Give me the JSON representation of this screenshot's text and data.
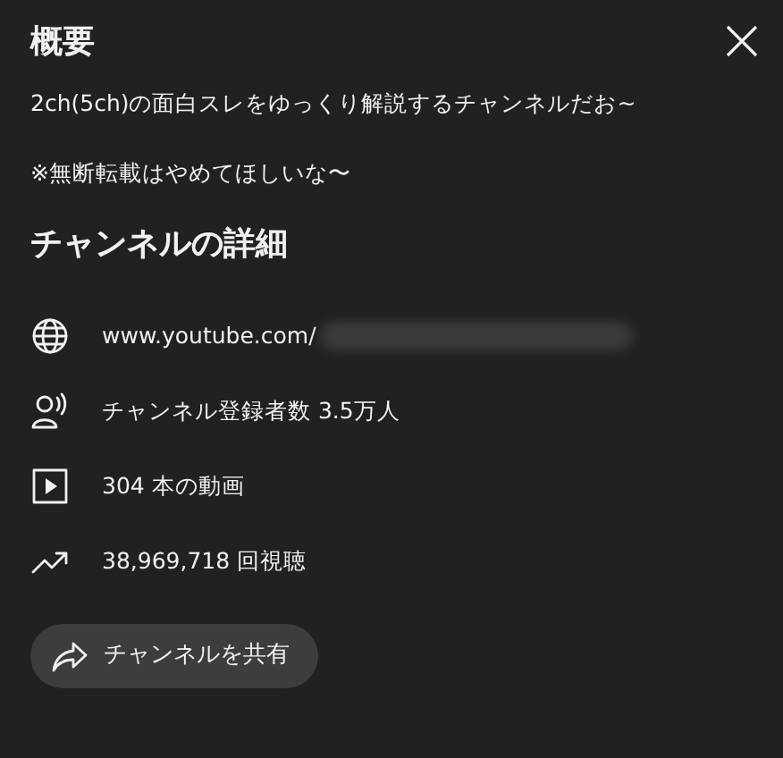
{
  "title": "概要",
  "description": [
    "2ch(5ch)の面白スレをゆっくり解説するチャンネルだお~",
    "※無断転載はやめてほしいな〜"
  ],
  "details_heading": "チャンネルの詳細",
  "details": [
    {
      "kind": "link",
      "text": "www.youtube.com/"
    },
    {
      "kind": "subscribers",
      "text": "チャンネル登録者数 3.5万人"
    },
    {
      "kind": "videos",
      "text": "304 本の動画"
    },
    {
      "kind": "views",
      "text": "38,969,718 回視聴"
    }
  ],
  "share_button": "チャンネルを共有"
}
